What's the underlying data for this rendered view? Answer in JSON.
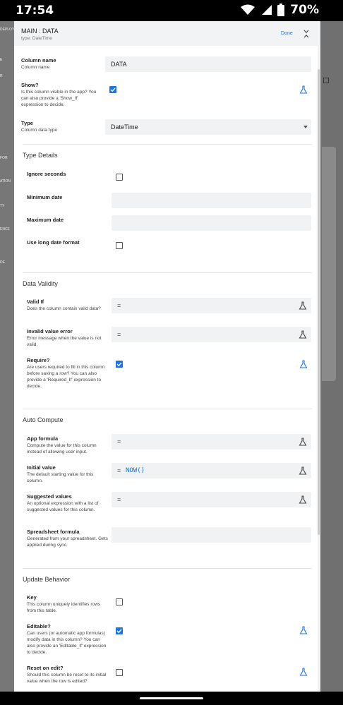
{
  "status_bar": {
    "time": "17:54",
    "battery": "70%"
  },
  "background": {
    "left_fragments": [
      "DEPLOY",
      "E",
      "R",
      "FOR",
      "ATION",
      "TY",
      "ENCE",
      "DE"
    ]
  },
  "dialog": {
    "title": "MAIN : DATA",
    "subtitle": "type: DateTime",
    "done": "Done"
  },
  "fields": {
    "column_name": {
      "label": "Column name",
      "desc": "Column name",
      "value": "DATA"
    },
    "show": {
      "label": "Show?",
      "desc": "Is this column visible in the app? You can also provide a 'Show_If' expression to decide.",
      "checked": true
    },
    "type": {
      "label": "Type",
      "desc": "Column data type",
      "value": "DateTime"
    }
  },
  "type_details": {
    "heading": "Type Details",
    "ignore_seconds": {
      "label": "Ignore seconds",
      "checked": false
    },
    "minimum_date": {
      "label": "Minimum date",
      "value": ""
    },
    "maximum_date": {
      "label": "Maximum date",
      "value": ""
    },
    "long_date": {
      "label": "Use long date format",
      "checked": false
    }
  },
  "data_validity": {
    "heading": "Data Validity",
    "valid_if": {
      "label": "Valid If",
      "desc": "Does the column contain valid data?",
      "eq": "="
    },
    "invalid_error": {
      "label": "Invalid value error",
      "desc": "Error message when the value is not valid.",
      "eq": "="
    },
    "require": {
      "label": "Require?",
      "desc": "Are users required to fill in this column before saving a row? You can also provide a 'Required_If' expression to decide.",
      "checked": true
    }
  },
  "auto_compute": {
    "heading": "Auto Compute",
    "app_formula": {
      "label": "App formula",
      "desc": "Compute the value for this column instead of allowing user input.",
      "eq": "="
    },
    "initial_value": {
      "label": "Initial value",
      "desc": "The default starting value for this column.",
      "eq": "=",
      "formula": "NOW()"
    },
    "suggested_values": {
      "label": "Suggested values",
      "desc": "An optional expression with a list of suggested values for this column.",
      "eq": "="
    },
    "spreadsheet_formula": {
      "label": "Spreadsheet formula",
      "desc": "Generated from your spreadsheet. Gets applied during sync.",
      "value": ""
    }
  },
  "update_behavior": {
    "heading": "Update Behavior",
    "key": {
      "label": "Key",
      "desc": "This column uniquely identifies rows from this table.",
      "checked": false
    },
    "editable": {
      "label": "Editable?",
      "desc": "Can users (or automatic app formulas) modify data in this column? You can also provide an 'Editable_If' expression to decide.",
      "checked": true
    },
    "reset_on_edit": {
      "label": "Reset on edit?",
      "desc": "Should this column be reset to its initial value when the row is edited?",
      "checked": false
    }
  },
  "icons": {
    "status": [
      "wifi-icon",
      "signal-icon",
      "battery-icon"
    ],
    "expression": "flask-icon",
    "collapse": "collapse-icon",
    "dropdown": "chevron-down-icon"
  },
  "colors": {
    "accent": "#1a73e8",
    "header_bg": "#f2f3f5",
    "field_bg": "#f1f2f3",
    "overlay": "#5c5c5c"
  }
}
